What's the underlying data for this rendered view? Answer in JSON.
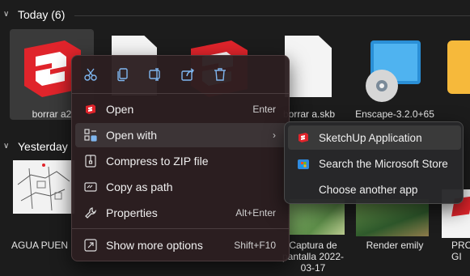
{
  "groups": {
    "today_label": "Today (6)",
    "yesterday_label": "Yesterday"
  },
  "files_today": [
    {
      "name": "borrar a2",
      "icon": "sketchup-icon"
    },
    {
      "name": "",
      "icon": "document-icon"
    },
    {
      "name": "",
      "icon": "sketchup-icon"
    },
    {
      "name": "borrar a.skb",
      "icon": "document-icon"
    },
    {
      "name": "Enscape-3.2.0+65",
      "icon": "installer-icon"
    },
    {
      "name": "",
      "icon": "folder-icon"
    }
  ],
  "files_yesterday": [
    {
      "name": "AGUA PUEN",
      "icon": "map-thumbnail"
    },
    {
      "name": "Captura de pantalla 2022-03-17",
      "icon": "image-thumbnail"
    },
    {
      "name": "Render emily",
      "icon": "image-thumbnail"
    },
    {
      "name": "PRO GI",
      "icon": "sketchup-icon"
    }
  ],
  "toolbar": [
    {
      "name": "cut-icon"
    },
    {
      "name": "copy-icon"
    },
    {
      "name": "rename-icon"
    },
    {
      "name": "share-icon"
    },
    {
      "name": "delete-icon"
    }
  ],
  "menu": {
    "open": {
      "label": "Open",
      "shortcut": "Enter"
    },
    "open_with": {
      "label": "Open with"
    },
    "compress": {
      "label": "Compress to ZIP file"
    },
    "copy_path": {
      "label": "Copy as path"
    },
    "properties": {
      "label": "Properties",
      "shortcut": "Alt+Enter"
    },
    "more_options": {
      "label": "Show more options",
      "shortcut": "Shift+F10"
    }
  },
  "submenu": {
    "sketchup": "SketchUp Application",
    "store": "Search the Microsoft Store",
    "another": "Choose another app"
  },
  "colors": {
    "accent": "#7fb6ef",
    "sketchup_red": "#e0242b"
  }
}
